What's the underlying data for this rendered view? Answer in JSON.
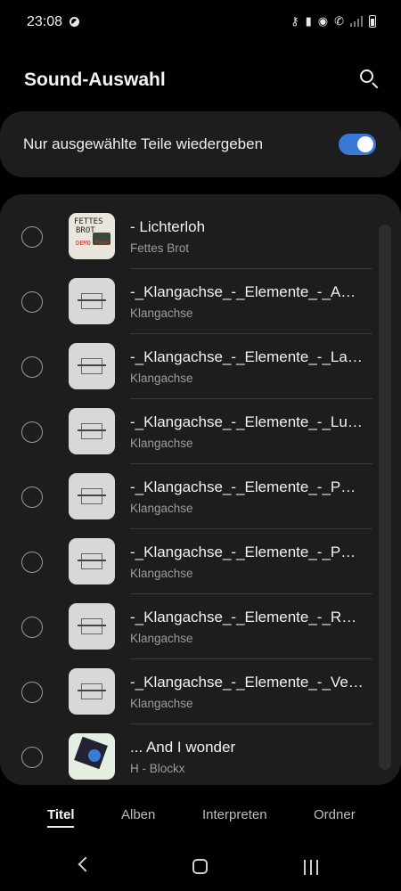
{
  "status_bar": {
    "time": "23:08",
    "icons": [
      "dnd-icon",
      "key-icon",
      "sim-icon",
      "wifi-icon",
      "wifi-call-icon",
      "signal-icon",
      "battery-icon"
    ]
  },
  "header": {
    "title": "Sound-Auswahl",
    "search_icon": "search-icon"
  },
  "toggle": {
    "label": "Nur ausgewählte Teile wiedergeben",
    "enabled": true,
    "accent_color": "#3a78d8"
  },
  "tracks": [
    {
      "title": "- Lichterloh",
      "artist": "Fettes Brot",
      "art": "fettes-brot-album-art",
      "selected": false
    },
    {
      "title": "-_Klangachse_-_Elemente_-_Am…",
      "artist": "Klangachse",
      "art": "klangachse-album-art",
      "selected": false
    },
    {
      "title": "-_Klangachse_-_Elemente_-_Las…",
      "artist": "Klangachse",
      "art": "klangachse-album-art",
      "selected": false
    },
    {
      "title": "-_Klangachse_-_Elemente_-_Lun…",
      "artist": "Klangachse",
      "art": "klangachse-album-art",
      "selected": false
    },
    {
      "title": "-_Klangachse_-_Elemente_-_Per…",
      "artist": "Klangachse",
      "art": "klangachse-album-art",
      "selected": false
    },
    {
      "title": "-_Klangachse_-_Elemente_-_Pha…",
      "artist": "Klangachse",
      "art": "klangachse-album-art",
      "selected": false
    },
    {
      "title": "-_Klangachse_-_Elemente_-_Red…",
      "artist": "Klangachse",
      "art": "klangachse-album-art",
      "selected": false
    },
    {
      "title": "-_Klangachse_-_Elemente_-_Ver…",
      "artist": "Klangachse",
      "art": "klangachse-album-art",
      "selected": false
    },
    {
      "title": "... And I wonder",
      "artist": "H - Blockx",
      "art": "h-blockx-album-art",
      "selected": false
    }
  ],
  "art_text": {
    "fettes_line1": "FETTES",
    "fettes_line2": "BROT",
    "fettes_line3": "DEMO TAPE"
  },
  "tabs": [
    {
      "label": "Titel",
      "active": true
    },
    {
      "label": "Alben",
      "active": false
    },
    {
      "label": "Interpreten",
      "active": false
    },
    {
      "label": "Ordner",
      "active": false
    }
  ],
  "nav": {
    "icons": [
      "back-icon",
      "home-icon",
      "recent-apps-icon"
    ]
  }
}
